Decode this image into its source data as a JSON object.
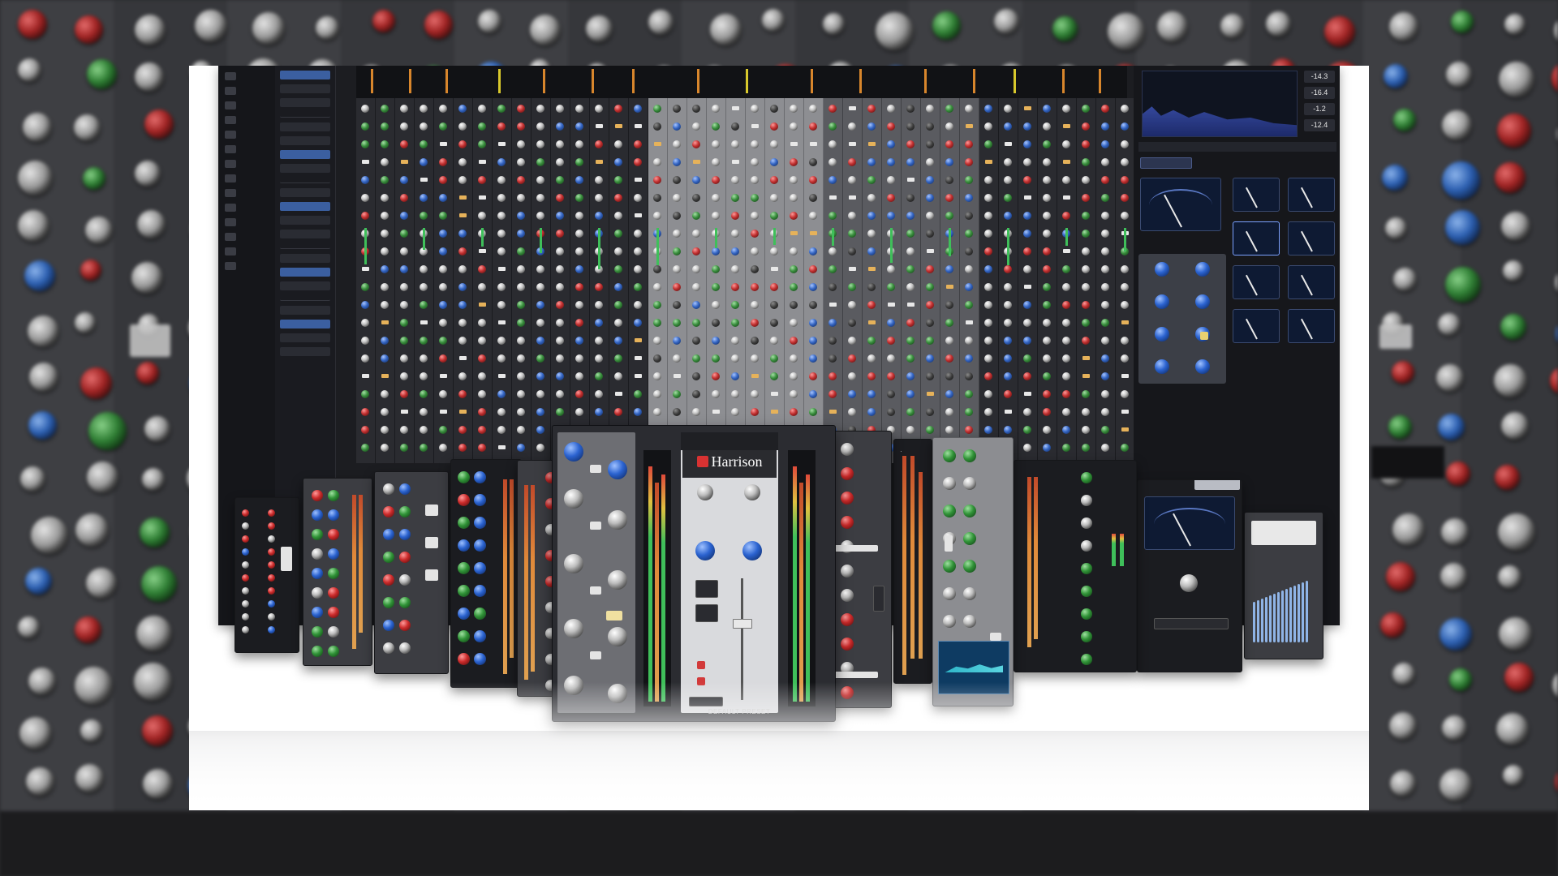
{
  "plugin": {
    "brand": "Harrison",
    "footer_label": "DEFAULT PRESET"
  },
  "analyzer": {
    "readouts": [
      "-14.3",
      "-16.4",
      "-1.2",
      "-12.4"
    ]
  },
  "colors": {
    "frame": "#ffffff",
    "daw_background": "#1c1d21",
    "accent_orange": "#d8862c",
    "brand_red": "#d83232",
    "meter_green": "#3fbf5a",
    "vu_blue": "#0e1a33"
  },
  "icons": [
    "harrison-logo-icon",
    "vu-meter-icon",
    "spectrum-analyzer-icon",
    "knob-icon",
    "fader-icon"
  ]
}
